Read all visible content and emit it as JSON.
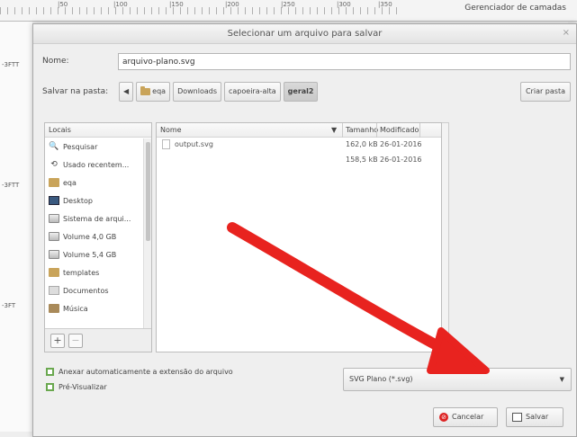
{
  "background": {
    "ruler_labels": [
      "|50",
      "|100",
      "|150",
      "|200",
      "|250",
      "|300",
      "|350"
    ],
    "layers_tab": "Gerenciador de camadas",
    "canvas_marks": [
      "-3FTT",
      "-3FTT",
      "-3FT"
    ]
  },
  "dialog": {
    "title": "Selecionar um arquivo para salvar",
    "close_glyph": "×"
  },
  "name_row": {
    "label": "Nome:",
    "value": "arquivo-plano.svg"
  },
  "folder_row": {
    "label": "Salvar na pasta:",
    "back_glyph": "◀",
    "crumbs": [
      "eqa",
      "Downloads",
      "capoeira-alta",
      "geral2"
    ],
    "create_button": "Criar pasta"
  },
  "places": {
    "header": "Locais",
    "items": [
      {
        "icon": "search-icon",
        "glyph": "🔍",
        "label": "Pesquisar"
      },
      {
        "icon": "recent-icon",
        "glyph": "⟲",
        "label": "Usado recentem..."
      },
      {
        "icon": "home-folder-icon",
        "glyph": "",
        "label": "eqa"
      },
      {
        "icon": "desktop-icon",
        "glyph": "",
        "label": "Desktop"
      },
      {
        "icon": "drive-icon",
        "glyph": "",
        "label": "Sistema de arqui..."
      },
      {
        "icon": "drive-icon",
        "glyph": "",
        "label": "Volume 4,0 GB"
      },
      {
        "icon": "drive-icon",
        "glyph": "",
        "label": "Volume 5,4 GB"
      },
      {
        "icon": "folder-icon",
        "glyph": "",
        "label": "templates"
      },
      {
        "icon": "documents-icon",
        "glyph": "",
        "label": "Documentos"
      },
      {
        "icon": "music-icon",
        "glyph": "",
        "label": "Música"
      }
    ],
    "add_glyph": "+",
    "remove_glyph": "−"
  },
  "files": {
    "columns": {
      "name": "Nome",
      "sort_glyph": "▼",
      "size": "Tamanho",
      "modified": "Modificado"
    },
    "rows": [
      {
        "name": "output.svg",
        "size": "162,0 kB",
        "modified": "26-01-2016"
      },
      {
        "name": "",
        "size": "158,5 kB",
        "modified": "26-01-2016"
      }
    ]
  },
  "options": {
    "auto_extension": "Anexar automaticamente a extensão do arquivo",
    "preview": "Pré-Visualizar"
  },
  "filetype": {
    "value": "SVG Plano (*.svg)",
    "dropdown_glyph": "▼"
  },
  "buttons": {
    "cancel": "Cancelar",
    "save": "Salvar",
    "cancel_glyph": "⊘"
  },
  "annotation": {
    "color": "#e8231f"
  }
}
